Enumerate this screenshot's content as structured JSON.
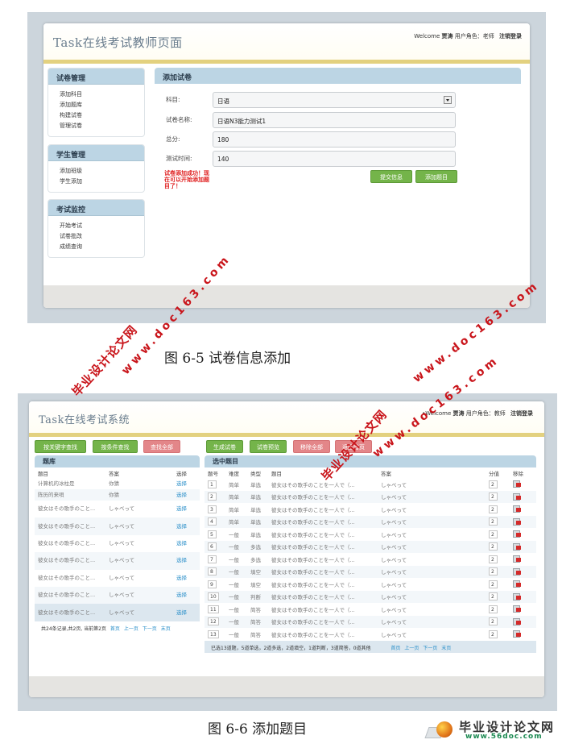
{
  "figure1": {
    "app_title": "Task在线考试教师页面",
    "userbar": {
      "welcome": "Welcome",
      "username": "贾涛",
      "role_label": "用户角色：",
      "role": "老师",
      "logout": "注销登录"
    },
    "sidebar": [
      {
        "title": "试卷管理",
        "items": [
          "添加科目",
          "添加题库",
          "构建试卷",
          "管理试卷"
        ]
      },
      {
        "title": "学生管理",
        "items": [
          "添加班级",
          "学生添加"
        ]
      },
      {
        "title": "考试监控",
        "items": [
          "开始考试",
          "试卷批改",
          "成绩查询"
        ]
      }
    ],
    "panel_title": "添加试卷",
    "form": {
      "subject_label": "科目:",
      "subject_value": "日语",
      "name_label": "试卷名称:",
      "name_value": "日语N3能力测试1",
      "score_label": "总分:",
      "score_value": "180",
      "time_label": "测试时间:",
      "time_value": "140"
    },
    "success_message": "试卷添加成功！现在可以开始添加题目了！",
    "buttons": {
      "submit": "提交信息",
      "add_questions": "添加题目"
    },
    "caption": "图 6-5  试卷信息添加"
  },
  "figure2": {
    "app_title": "Task在线考试系统",
    "userbar": {
      "welcome": "•Welcome",
      "username": "贾涛",
      "role_label": "用户角色：",
      "role": "教师",
      "logout": "注销登录"
    },
    "toolbar_left": [
      "按关键字查找",
      "按条件查找",
      "查找全部"
    ],
    "toolbar_right": [
      "生成试卷",
      "试卷预览",
      "移除全部",
      "返回首页"
    ],
    "question_bank": {
      "title": "题库",
      "columns": [
        "题目",
        "答案",
        "选择"
      ],
      "rows": [
        {
          "question": "计算机的冰柱是",
          "answer": "你猜",
          "action": "选择"
        },
        {
          "question": "陈历的来唄",
          "answer": "你猜",
          "action": "选择"
        },
        {
          "question": "彼女はその歌手のこと...",
          "answer": "しゃべって",
          "action": "选择"
        },
        {
          "question": "彼女はその歌手のこと...",
          "answer": "しゃべって",
          "action": "选择"
        },
        {
          "question": "彼女はその歌手のこと...",
          "answer": "しゃべって",
          "action": "选择"
        },
        {
          "question": "彼女はその歌手のこと...",
          "answer": "しゃべって",
          "action": "选择"
        },
        {
          "question": "彼女はその歌手のこと...",
          "answer": "しゃべって",
          "action": "选择"
        },
        {
          "question": "彼女はその歌手のこと...",
          "answer": "しゃべって",
          "action": "选择"
        },
        {
          "question": "彼女はその歌手のこと...",
          "answer": "しゃべって",
          "action": "选择"
        }
      ],
      "pager_text": "共24条记录,共2页, 当前第2页",
      "pager_links": [
        "首页",
        "上一页",
        "下一页",
        "末页"
      ]
    },
    "selected": {
      "title": "选中题目",
      "columns": [
        "题号",
        "难度",
        "类型",
        "题目",
        "答案",
        "分值",
        "移除"
      ],
      "rows": [
        {
          "no": "1",
          "difficulty": "简单",
          "type": "单选",
          "question": "彼女はその歌手のことを一人で（...",
          "answer": "しゃべって",
          "score": "2"
        },
        {
          "no": "2",
          "difficulty": "简单",
          "type": "单选",
          "question": "彼女はその歌手のことを一人で（...",
          "answer": "しゃべって",
          "score": "2"
        },
        {
          "no": "3",
          "difficulty": "简单",
          "type": "单选",
          "question": "彼女はその歌手のことを一人で（...",
          "answer": "しゃべって",
          "score": "2"
        },
        {
          "no": "4",
          "difficulty": "简单",
          "type": "单选",
          "question": "彼女はその歌手のことを一人で（...",
          "answer": "しゃべって",
          "score": "2"
        },
        {
          "no": "5",
          "difficulty": "一般",
          "type": "单选",
          "question": "彼女はその歌手のことを一人で（...",
          "answer": "しゃべって",
          "score": "2"
        },
        {
          "no": "6",
          "difficulty": "一般",
          "type": "多选",
          "question": "彼女はその歌手のことを一人で（...",
          "answer": "しゃべって",
          "score": "2"
        },
        {
          "no": "7",
          "difficulty": "一般",
          "type": "多选",
          "question": "彼女はその歌手のことを一人で（...",
          "answer": "しゃべって",
          "score": "2"
        },
        {
          "no": "8",
          "difficulty": "一般",
          "type": "填空",
          "question": "彼女はその歌手のことを一人で（...",
          "answer": "しゃべって",
          "score": "2"
        },
        {
          "no": "9",
          "difficulty": "一般",
          "type": "填空",
          "question": "彼女はその歌手のことを一人で（...",
          "answer": "しゃべって",
          "score": "2"
        },
        {
          "no": "10",
          "difficulty": "一般",
          "type": "判断",
          "question": "彼女はその歌手のことを一人で（...",
          "answer": "しゃべって",
          "score": "2"
        },
        {
          "no": "11",
          "difficulty": "一般",
          "type": "简答",
          "question": "彼女はその歌手のことを一人で（...",
          "answer": "しゃべって",
          "score": "2"
        },
        {
          "no": "12",
          "difficulty": "一般",
          "type": "简答",
          "question": "彼女はその歌手のことを一人で（...",
          "answer": "しゃべって",
          "score": "2"
        },
        {
          "no": "13",
          "difficulty": "一般",
          "type": "简答",
          "question": "彼女はその歌手のことを一人で（...",
          "answer": "しゃべって",
          "score": "2"
        }
      ],
      "summary": "已选13道题，5道单选，2道多选，2道填空，1道判断，3道简答，0道其他",
      "pager_links": [
        "首页",
        "上一页",
        "下一页",
        "末页"
      ]
    },
    "caption": "图 6-6 添加题目"
  },
  "watermarks": {
    "site_cn": "毕业设计论文网",
    "site_url": "www.doc163.com"
  },
  "logo": {
    "name": "毕业设计论文网",
    "url": "www.56doc.com"
  },
  "colors": {
    "header_stripe": "#e3d17f",
    "panel_header": "#bcd5e4",
    "btn_green": "#74b44a",
    "btn_red": "#e38689",
    "link": "#2a8fc9",
    "error": "#e02020"
  }
}
